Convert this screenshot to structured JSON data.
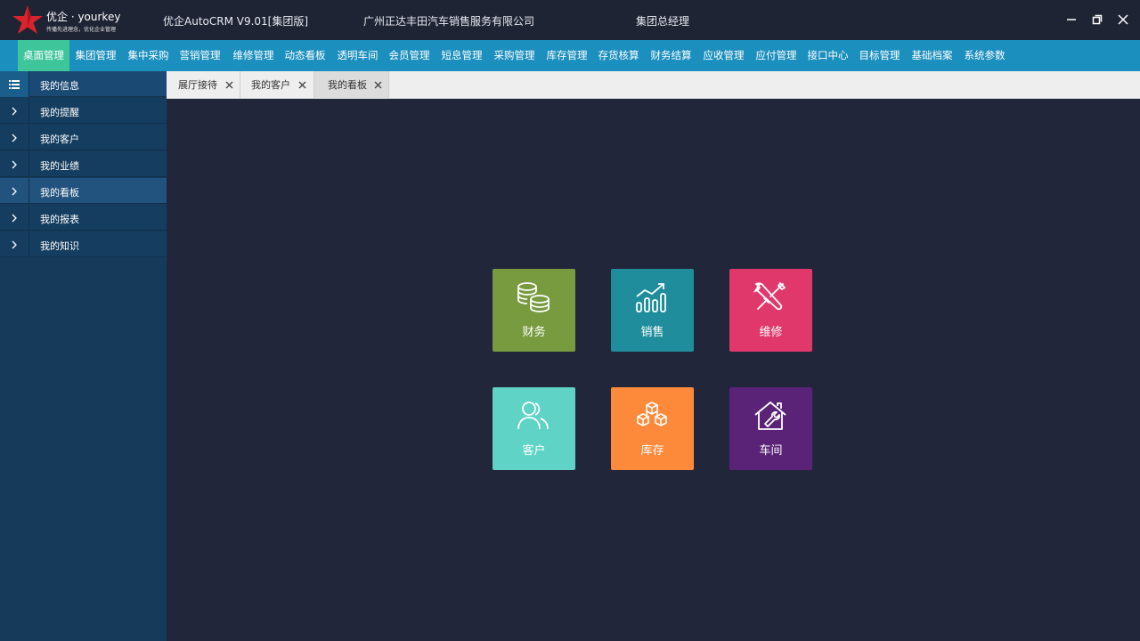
{
  "titlebar": {
    "logo_name": "优企 · yourkey",
    "logo_tagline": "传播先进理念，优化企业管理",
    "app_title": "优企AutoCRM V9.01[集团版]",
    "company": "广州正达丰田汽车销售服务有限公司",
    "role": "集团总经理",
    "buttons": {
      "minimize": "minimize-icon",
      "restore": "restore-icon",
      "close": "close-icon"
    }
  },
  "menu": {
    "active_color": "#3ec59a",
    "bar_color": "#1b8fbe",
    "items": [
      "桌面管理",
      "集团管理",
      "集中采购",
      "营销管理",
      "维修管理",
      "动态看板",
      "透明车间",
      "会员管理",
      "短息管理",
      "采购管理",
      "库存管理",
      "存货核算",
      "财务结算",
      "应收管理",
      "应付管理",
      "接口中心",
      "目标管理",
      "基础档案",
      "系统参数"
    ]
  },
  "sidebar": {
    "items": [
      "我的信息",
      "我的提醒",
      "我的客户",
      "我的业绩",
      "我的看板",
      "我的报表",
      "我的知识"
    ]
  },
  "tabs": [
    "展厅接待",
    "我的客户",
    "我的看板"
  ],
  "tiles": [
    {
      "label": "财务",
      "color": "#789b3f",
      "icon": "coins-icon"
    },
    {
      "label": "销售",
      "color": "#1f8d9c",
      "icon": "bar-chart-trend-icon"
    },
    {
      "label": "维修",
      "color": "#e0386a",
      "icon": "wrench-screwdriver-icon"
    },
    {
      "label": "客户",
      "color": "#5fd3c5",
      "icon": "users-icon"
    },
    {
      "label": "库存",
      "color": "#fd8a3b",
      "icon": "boxes-icon"
    },
    {
      "label": "车间",
      "color": "#5a2378",
      "icon": "house-wrench-icon"
    }
  ]
}
